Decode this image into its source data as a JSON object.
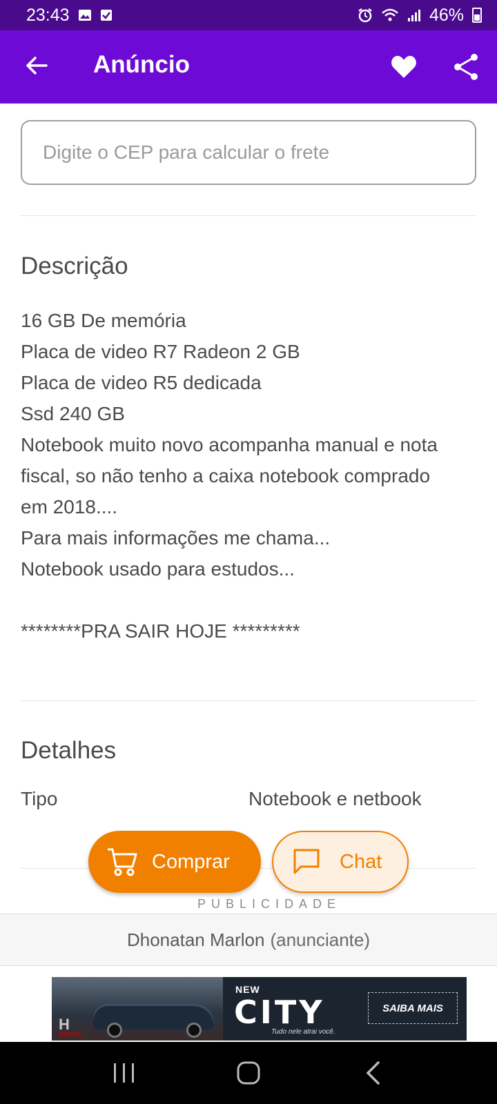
{
  "status_bar": {
    "time": "23:43",
    "battery": "46%"
  },
  "app_bar": {
    "title": "Anúncio"
  },
  "cep": {
    "placeholder": "Digite o CEP para calcular o frete"
  },
  "description": {
    "title": "Descrição",
    "lines": [
      "16 GB De memória",
      "Placa de video R7 Radeon 2 GB",
      "Placa de video R5 dedicada",
      "Ssd 240 GB",
      "Notebook muito novo acompanha manual e nota",
      "fiscal, so não tenho a caixa notebook comprado",
      "em 2018....",
      "Para mais informações me chama...",
      "Notebook usado para estudos...",
      "",
      "********PRA SAIR HOJE *********"
    ]
  },
  "details": {
    "title": "Detalhes",
    "rows": [
      {
        "label": "Tipo",
        "value": "Notebook e netbook"
      }
    ]
  },
  "actions": {
    "buy_label": "Comprar",
    "chat_label": "Chat"
  },
  "ad": {
    "label": "PUBLICIDADE",
    "banner": {
      "new": "NEW",
      "model": "CITY",
      "tagline": "Tudo nele atrai você.",
      "cta": "SAIBA MAIS",
      "brand": "HONDA"
    }
  },
  "seller": {
    "name": "Dhonatan Marlon",
    "role": "(anunciante)"
  },
  "colors": {
    "status_bar": "#4a0a8c",
    "app_bar": "#6e0ad6",
    "accent_orange": "#f28000"
  },
  "icons": [
    "image-icon",
    "checkbox-icon",
    "alarm-icon",
    "wifi-icon",
    "signal-icon",
    "battery-icon",
    "back-arrow-icon",
    "heart-icon",
    "share-icon",
    "cart-icon",
    "chat-bubble-icon",
    "recent-apps-icon",
    "home-icon",
    "back-icon"
  ]
}
